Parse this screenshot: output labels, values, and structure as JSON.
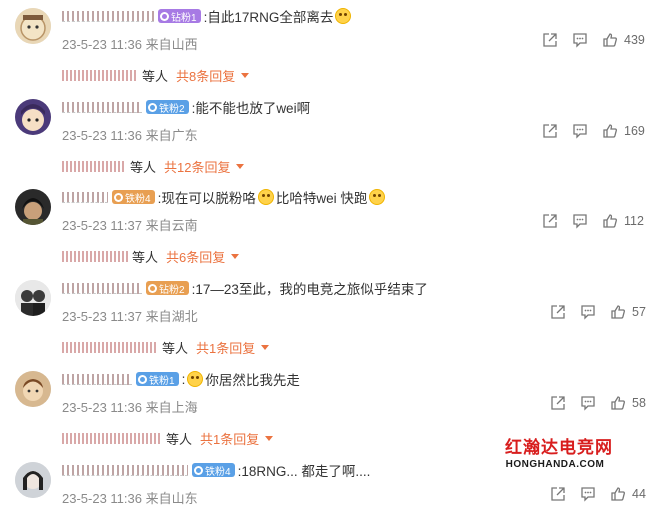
{
  "comments": [
    {
      "badge": "钻粉1",
      "badge_color": "purple",
      "text_before": ":自此17RNG全部离去",
      "text_after": "",
      "emoji": "crying-emoji",
      "time": "23-5-23 11:36 来自山西",
      "likes": "439",
      "reply_label": "等人",
      "reply_count": "共8条回复"
    },
    {
      "badge": "铁粉2",
      "badge_color": "blue",
      "text_before": ":能不能也放了wei啊",
      "text_after": "",
      "emoji": "",
      "time": "23-5-23 11:36 来自广东",
      "likes": "169",
      "reply_label": "等人",
      "reply_count": "共12条回复"
    },
    {
      "badge": "铁粉4",
      "badge_color": "orange",
      "text_before": ":现在可以脱粉咯",
      "text_after": "比哈特wei 快跑",
      "emoji": "scared-emoji",
      "time": "23-5-23 11:37 来自云南",
      "likes": "112",
      "reply_label": "等人",
      "reply_count": "共6条回复"
    },
    {
      "badge": "钻粉2",
      "badge_color": "orange",
      "text_before": ":17—23至此，我的电竞之旅似乎结束了",
      "text_after": "",
      "emoji": "",
      "time": "23-5-23 11:37 来自湖北",
      "likes": "57",
      "reply_label": "等人",
      "reply_count": "共1条回复"
    },
    {
      "badge": "铁粉1",
      "badge_color": "blue",
      "text_before": ":",
      "text_after": "你居然比我先走",
      "emoji": "crying-emoji",
      "time": "23-5-23 11:36 来自上海",
      "likes": "58",
      "reply_label": "等人",
      "reply_count": "共1条回复"
    },
    {
      "badge": "铁粉4",
      "badge_color": "blue",
      "text_before": ":18RNG... 都走了啊....",
      "text_after": "",
      "emoji": "",
      "time": "23-5-23 11:36 来自山东",
      "likes": "44",
      "reply_label": "",
      "reply_count": ""
    }
  ],
  "watermark": {
    "main": "红瀚达电竞网",
    "sub": "HONGHANDA.COM"
  }
}
